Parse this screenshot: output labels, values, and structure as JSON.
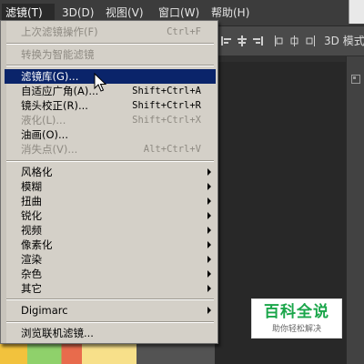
{
  "menubar": {
    "items": [
      {
        "label": "滤镜(T)",
        "active": true
      },
      {
        "label": "3D(D)",
        "active": false
      },
      {
        "label": "视图(V)",
        "active": false
      },
      {
        "label": "窗口(W)",
        "active": false
      },
      {
        "label": "帮助(H)",
        "active": false
      }
    ]
  },
  "options_bar": {
    "mode_label": "3D 模式"
  },
  "filter_menu": {
    "items": [
      {
        "label": "上次滤镜操作(F)",
        "shortcut": "Ctrl+F",
        "disabled": true
      },
      {
        "label": "转换为智能滤镜",
        "disabled": true
      },
      {
        "label": "滤镜库(G)...",
        "highlight": true
      },
      {
        "label": "自适应广角(A)...",
        "shortcut": "Shift+Ctrl+A"
      },
      {
        "label": "镜头校正(R)...",
        "shortcut": "Shift+Ctrl+R"
      },
      {
        "label": "液化(L)...",
        "shortcut": "Shift+Ctrl+X",
        "disabled": true
      },
      {
        "label": "油画(O)..."
      },
      {
        "label": "消失点(V)...",
        "shortcut": "Alt+Ctrl+V",
        "disabled": true
      },
      {
        "label": "风格化",
        "submenu": true
      },
      {
        "label": "模糊",
        "submenu": true
      },
      {
        "label": "扭曲",
        "submenu": true
      },
      {
        "label": "锐化",
        "submenu": true
      },
      {
        "label": "视频",
        "submenu": true
      },
      {
        "label": "像素化",
        "submenu": true
      },
      {
        "label": "渲染",
        "submenu": true
      },
      {
        "label": "杂色",
        "submenu": true
      },
      {
        "label": "其它",
        "submenu": true
      },
      {
        "label": "Digimarc",
        "submenu": true
      },
      {
        "label": "浏览联机滤镜..."
      }
    ]
  },
  "watermark": {
    "title": "百科全说",
    "subtitle": "助你轻松解决"
  },
  "colors": {
    "menu_background": "#d4d0c8",
    "highlight": "#0a246a",
    "disabled_text": "#8e8a82",
    "watermark_green": "#1aa64a"
  }
}
